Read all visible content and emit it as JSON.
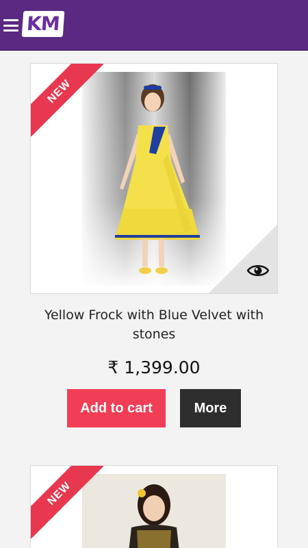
{
  "header": {
    "logo_text": "KM",
    "brand_color": "#5a2a82"
  },
  "products": [
    {
      "badge": "NEW",
      "title": "Yellow Frock with Blue Velvet with stones",
      "price": "₹ 1,399.00",
      "add_to_cart_label": "Add to cart",
      "more_label": "More",
      "quick_view_icon": "eye-icon"
    },
    {
      "badge": "NEW"
    }
  ],
  "colors": {
    "accent": "#f13e56",
    "dark_button": "#2e2e2e",
    "ribbon": "#e8384f"
  }
}
